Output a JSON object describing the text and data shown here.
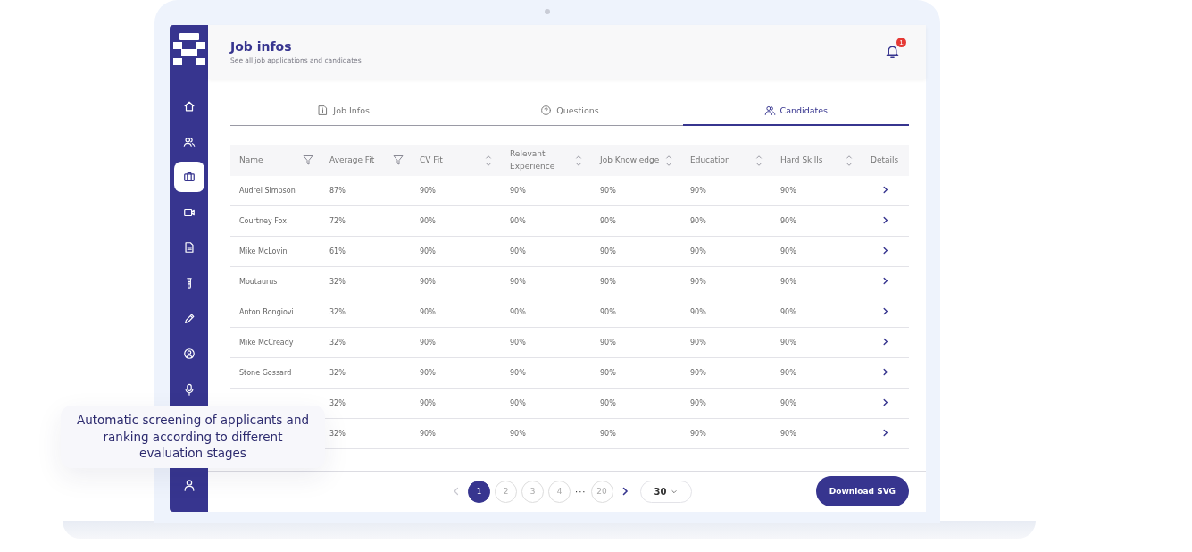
{
  "header": {
    "title": "Job infos",
    "subtitle": "See all job applications and candidates",
    "notifications": "1"
  },
  "sidebar": {
    "items": [
      {
        "kind": "home",
        "selected": false
      },
      {
        "kind": "users",
        "selected": false
      },
      {
        "kind": "briefcase",
        "selected": true
      },
      {
        "kind": "video",
        "selected": false
      },
      {
        "kind": "document",
        "selected": false
      },
      {
        "kind": "tube",
        "selected": false
      },
      {
        "kind": "pencil",
        "selected": false
      },
      {
        "kind": "profile",
        "selected": false
      },
      {
        "kind": "mic",
        "selected": false
      },
      {
        "kind": "user",
        "selected": false
      }
    ]
  },
  "tabs": [
    {
      "label": "Job Infos",
      "kind": "info",
      "selected": false
    },
    {
      "label": "Questions",
      "kind": "question",
      "selected": false
    },
    {
      "label": "Candidates",
      "kind": "users",
      "selected": true
    }
  ],
  "table": {
    "columns": [
      {
        "label": "Name",
        "kind": "filter"
      },
      {
        "label": "Average Fit",
        "kind": "filter"
      },
      {
        "label": "CV Fit",
        "kind": "sort"
      },
      {
        "label": "Relevant Experience",
        "kind": "sort"
      },
      {
        "label": "Job Knowledge",
        "kind": "sort"
      },
      {
        "label": "Education",
        "kind": "sort"
      },
      {
        "label": "Hard Skills",
        "kind": "sort"
      },
      {
        "label": "Details",
        "kind": "plain"
      }
    ],
    "rows": [
      {
        "cells": [
          "Audrei Simpson",
          "87%",
          "90%",
          "90%",
          "90%",
          "90%",
          "90%"
        ]
      },
      {
        "cells": [
          "Courtney Fox",
          "72%",
          "90%",
          "90%",
          "90%",
          "90%",
          "90%"
        ]
      },
      {
        "cells": [
          "Mike McLovin",
          "61%",
          "90%",
          "90%",
          "90%",
          "90%",
          "90%"
        ]
      },
      {
        "cells": [
          "Moutaurus",
          "32%",
          "90%",
          "90%",
          "90%",
          "90%",
          "90%"
        ]
      },
      {
        "cells": [
          "Anton Bongiovi",
          "32%",
          "90%",
          "90%",
          "90%",
          "90%",
          "90%"
        ]
      },
      {
        "cells": [
          "Mike McCready",
          "32%",
          "90%",
          "90%",
          "90%",
          "90%",
          "90%"
        ]
      },
      {
        "cells": [
          "Stone Gossard",
          "32%",
          "90%",
          "90%",
          "90%",
          "90%",
          "90%"
        ]
      },
      {
        "cells": [
          null,
          "32%",
          "90%",
          "90%",
          "90%",
          "90%",
          "90%"
        ]
      },
      {
        "cells": [
          null,
          "32%",
          "90%",
          "90%",
          "90%",
          "90%",
          "90%"
        ]
      }
    ]
  },
  "pagination": {
    "prev_disabled": true,
    "pages": [
      {
        "kind": "page",
        "label": "1",
        "selected": true
      },
      {
        "kind": "page",
        "label": "2",
        "selected": false
      },
      {
        "kind": "page",
        "label": "3",
        "selected": false
      },
      {
        "kind": "page",
        "label": "4",
        "selected": false
      },
      {
        "kind": "gap",
        "label": "···"
      },
      {
        "kind": "page",
        "label": "20",
        "selected": false
      }
    ],
    "per_page": "30"
  },
  "download_button": "Download SVG",
  "caption": "Automatic screening of applicants and ranking according to different evaluation stages"
}
